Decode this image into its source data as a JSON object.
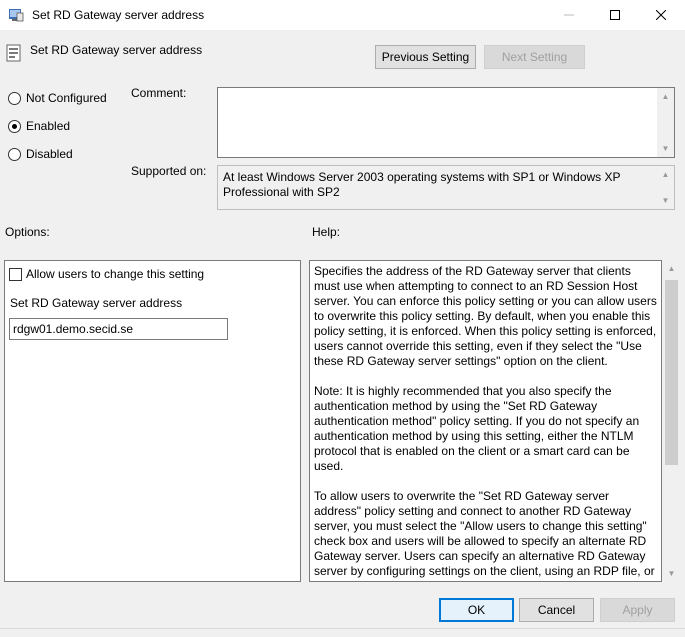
{
  "window": {
    "title": "Set RD Gateway server address",
    "header_title": "Set RD Gateway server address",
    "icons": {
      "app": "policy-app-icon",
      "header": "policy-setting-icon"
    }
  },
  "nav": {
    "previous_label": "Previous Setting",
    "next_label": "Next Setting"
  },
  "state": {
    "options": [
      {
        "label": "Not Configured",
        "checked": false
      },
      {
        "label": "Enabled",
        "checked": true
      },
      {
        "label": "Disabled",
        "checked": false
      }
    ]
  },
  "comment": {
    "label": "Comment:",
    "value": ""
  },
  "supported": {
    "label": "Supported on:",
    "text": "At least Windows Server 2003 operating systems with SP1 or Windows XP Professional with SP2"
  },
  "options_section": {
    "label": "Options:",
    "allow_change_label": "Allow users to change this setting",
    "allow_change_checked": false,
    "server_label": "Set RD Gateway server address",
    "server_value": "rdgw01.demo.secid.se"
  },
  "help_section": {
    "label": "Help:",
    "paragraphs": [
      "Specifies the address of the RD Gateway server that clients must use when attempting to connect to an RD Session Host server. You can enforce this policy setting or you can allow users to overwrite this policy setting. By default, when you enable this policy setting, it is enforced. When this policy setting is enforced, users cannot override this setting, even if they select the \"Use these RD Gateway server settings\" option on the client.",
      "Note: It is highly recommended that you also specify the authentication method by using the \"Set RD Gateway authentication method\" policy setting. If you do not specify an authentication method by using this setting, either the NTLM protocol that is enabled on the client or a smart card can be used.",
      "To allow users to overwrite the \"Set RD Gateway server address\" policy setting and connect to another RD Gateway server, you must select the \"Allow users to change this setting\" check box and users will be allowed to specify an alternate RD Gateway server. Users can specify an alternative RD Gateway server by configuring settings on the client, using an RDP file, or using an"
    ]
  },
  "footer": {
    "ok_label": "OK",
    "cancel_label": "Cancel",
    "apply_label": "Apply"
  }
}
